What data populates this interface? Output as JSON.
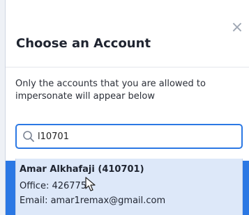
{
  "dialog": {
    "title": "Choose an Account",
    "close_glyph": "×",
    "description": "Only the accounts that you are allowed to impersonate will appear below"
  },
  "search": {
    "value": "l10701",
    "icon": "search-icon"
  },
  "results": [
    {
      "name": "Amar Alkhafaji (410701)",
      "office": "Office: 426775",
      "email": "Email: amar1remax@gmail.com"
    }
  ],
  "colors": {
    "accent": "#2b78e4",
    "dropdown_highlight": "#dde8f9"
  }
}
